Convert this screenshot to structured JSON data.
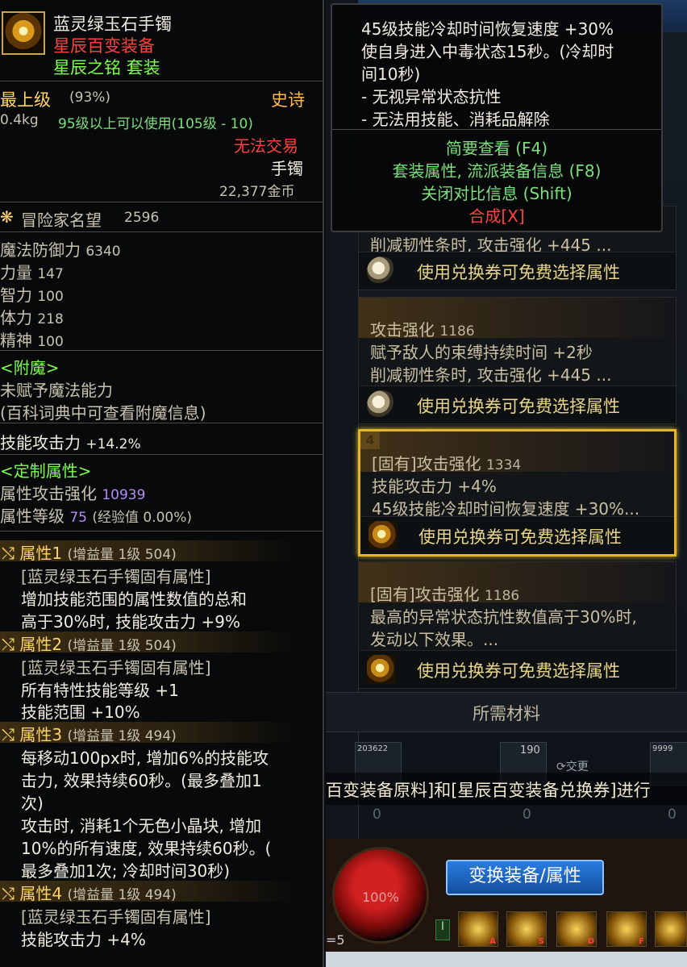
{
  "left_tooltip": {
    "item_name": "蓝灵绿玉石手镯",
    "set_line": "星辰百变装备",
    "set_name": "星辰之铭 套装",
    "grade": "最上级",
    "grade_pct": "(93%)",
    "rarity": "史诗",
    "weight": "0.4kg",
    "level_req": "95级以上可以使用(105级 - 10)",
    "untradeable": "无法交易",
    "slot_type": "手镯",
    "price": "22,377金币",
    "reputation_label": "冒险家名望",
    "reputation_value": "2596",
    "stats": [
      {
        "label": "魔法防御力",
        "value": "6340"
      },
      {
        "label": "力量",
        "value": "147"
      },
      {
        "label": "智力",
        "value": "100"
      },
      {
        "label": "体力",
        "value": "218"
      },
      {
        "label": "精神",
        "value": "100"
      }
    ],
    "enchant_header": "<附魔>",
    "enchant_none": "未赋予魔法能力",
    "enchant_hint": "(百科词典中可查看附魔信息)",
    "skill_atk_label": "技能攻击力",
    "skill_atk_value": "+14.2%",
    "custom_header": "<定制属性>",
    "attr_atk_label": "属性攻击强化",
    "attr_atk_value": "10939",
    "attr_level_label": "属性等级",
    "attr_level_value": "75",
    "attr_exp": "(经验值  0.00%)",
    "attributes": [
      {
        "title": "属性1",
        "detail": "(增益量 1级 504)",
        "lines": [
          "[蓝灵绿玉石手镯固有属性]",
          "增加技能范围的属性数值的总和",
          "高于30%时, 技能攻击力 +9%"
        ]
      },
      {
        "title": "属性2",
        "detail": "(增益量 1级 504)",
        "lines": [
          "[蓝灵绿玉石手镯固有属性]",
          "所有特性技能等级 +1",
          "技能范围 +10%"
        ]
      },
      {
        "title": "属性3",
        "detail": "(增益量 1级 494)",
        "lines": [
          "每移动100px时, 增加6%的技能攻",
          "击力, 效果持续60秒。(最多叠加1",
          "次)",
          "攻击时, 消耗1个无色小晶块, 增加",
          "10%的所有速度, 效果持续60秒。(",
          "最多叠加1次; 冷却时间30秒)"
        ]
      },
      {
        "title": "属性4",
        "detail": "(增益量 1级 494)",
        "lines": [
          "[蓝灵绿玉石手镯固有属性]",
          "技能攻击力 +4%"
        ]
      }
    ]
  },
  "right_tooltip": {
    "lines": [
      "45级技能冷却时间恢复速度 +30%",
      "使自身进入中毒状态15秒。(冷却时",
      "间10秒)",
      "- 无视异常状态抗性",
      "- 无法用技能、消耗品解除"
    ],
    "hotkeys": [
      "简要查看 (F4)",
      "套装属性, 流派装备信息 (F8)",
      "关闭对比信息 (Shift)"
    ],
    "synthesize": "合成[X]"
  },
  "cards": [
    {
      "lines": [
        "削减韧性条时, 攻击强化 +445 ..."
      ],
      "footer": "使用兑换券可免费选择属性"
    },
    {
      "title": "攻击强化",
      "title_num": "1186",
      "lines": [
        "赋予敌人的束缚持续时间 +2秒",
        "削减韧性条时, 攻击强化 +445 ..."
      ],
      "footer": "使用兑换券可免费选择属性"
    },
    {
      "badge": "4",
      "title": "[固有]攻击强化",
      "title_num": "1334",
      "lines": [
        "技能攻击力 +4%",
        "45级技能冷却时间恢复速度 +30%..."
      ],
      "footer": "使用兑换券可免费选择属性"
    },
    {
      "title": "[固有]攻击强化",
      "title_num": "1186",
      "lines": [
        "最高的异常状态抗性数值高于30%时,",
        "发动以下效果。..."
      ],
      "footer": "使用兑换券可免费选择属性"
    }
  ],
  "materials": {
    "header": "所需材料",
    "slot_counts": [
      "203622",
      "190",
      "9999"
    ],
    "exchange_hint": "交更",
    "notice": "百变装备原料]和[星辰百变装备兑换券]进行",
    "zeros": [
      "0",
      "0",
      "0"
    ]
  },
  "hud": {
    "hp": "100%",
    "exchange_button": "变换装备/属性",
    "skill_keys": [
      "I",
      "A",
      "S",
      "D",
      "F"
    ],
    "page": "=5"
  }
}
